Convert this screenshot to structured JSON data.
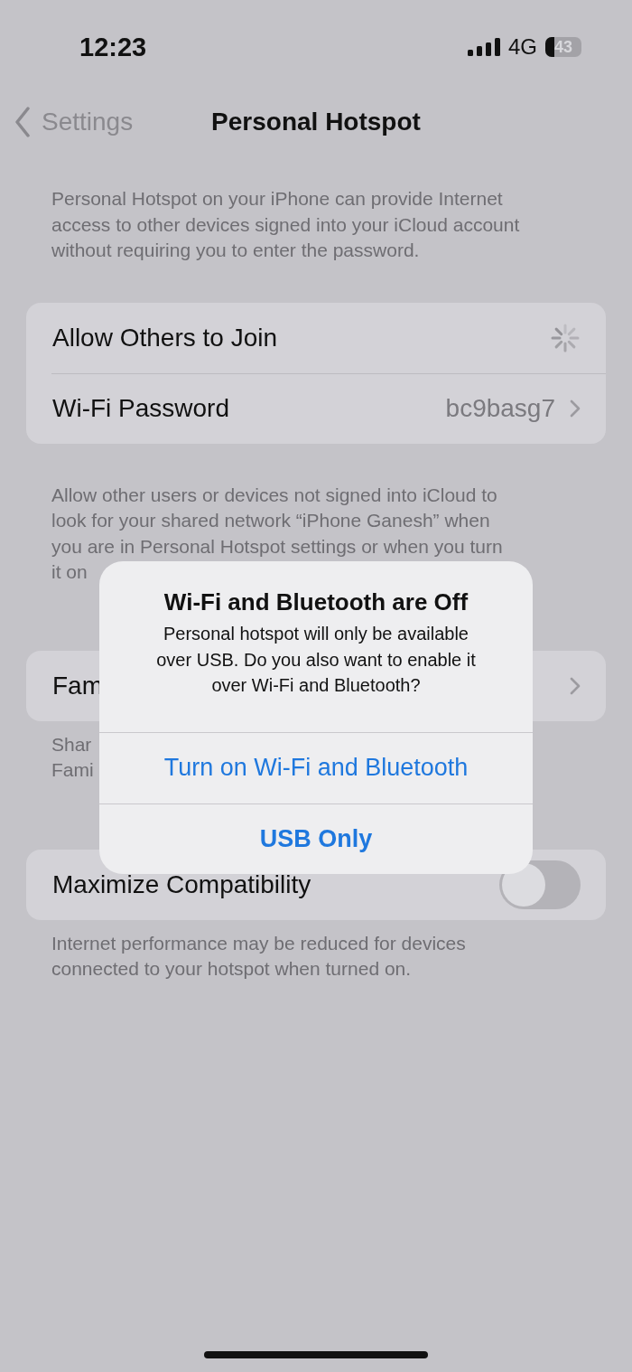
{
  "status_bar": {
    "time": "12:23",
    "network": "4G",
    "battery_percent": "43"
  },
  "nav": {
    "back_label": "Settings",
    "title": "Personal Hotspot"
  },
  "intro": "Personal Hotspot on your iPhone can provide Internet access to other devices signed into your iCloud account without requiring you to enter the password.",
  "group_1": [
    {
      "kind": "spinner",
      "label": "Allow Others to Join"
    },
    {
      "kind": "value",
      "label": "Wi-Fi Password",
      "value": "bc9basg7"
    }
  ],
  "group_1_footer_lines": [
    "Allow other users or devices not signed into iCloud to",
    "look for your shared network “iPhone Ganesh” when",
    "you are in Personal Hotspot settings or when you turn",
    "it on"
  ],
  "family_row": {
    "label": "Fam"
  },
  "family_footer_lines": [
    "Shar",
    "Fami"
  ],
  "compat_row": {
    "label": "Maximize Compatibility",
    "on": false
  },
  "compat_footer": "Internet performance may be reduced for devices connected to your hotspot when turned on.",
  "alert": {
    "title": "Wi-Fi and Bluetooth are Off",
    "message": "Personal hotspot will only be available over USB. Do you also want to enable it over Wi-Fi and Bluetooth?",
    "buttons": [
      {
        "label": "Turn on Wi-Fi and Bluetooth",
        "bold": false
      },
      {
        "label": "USB Only",
        "bold": true
      }
    ]
  }
}
